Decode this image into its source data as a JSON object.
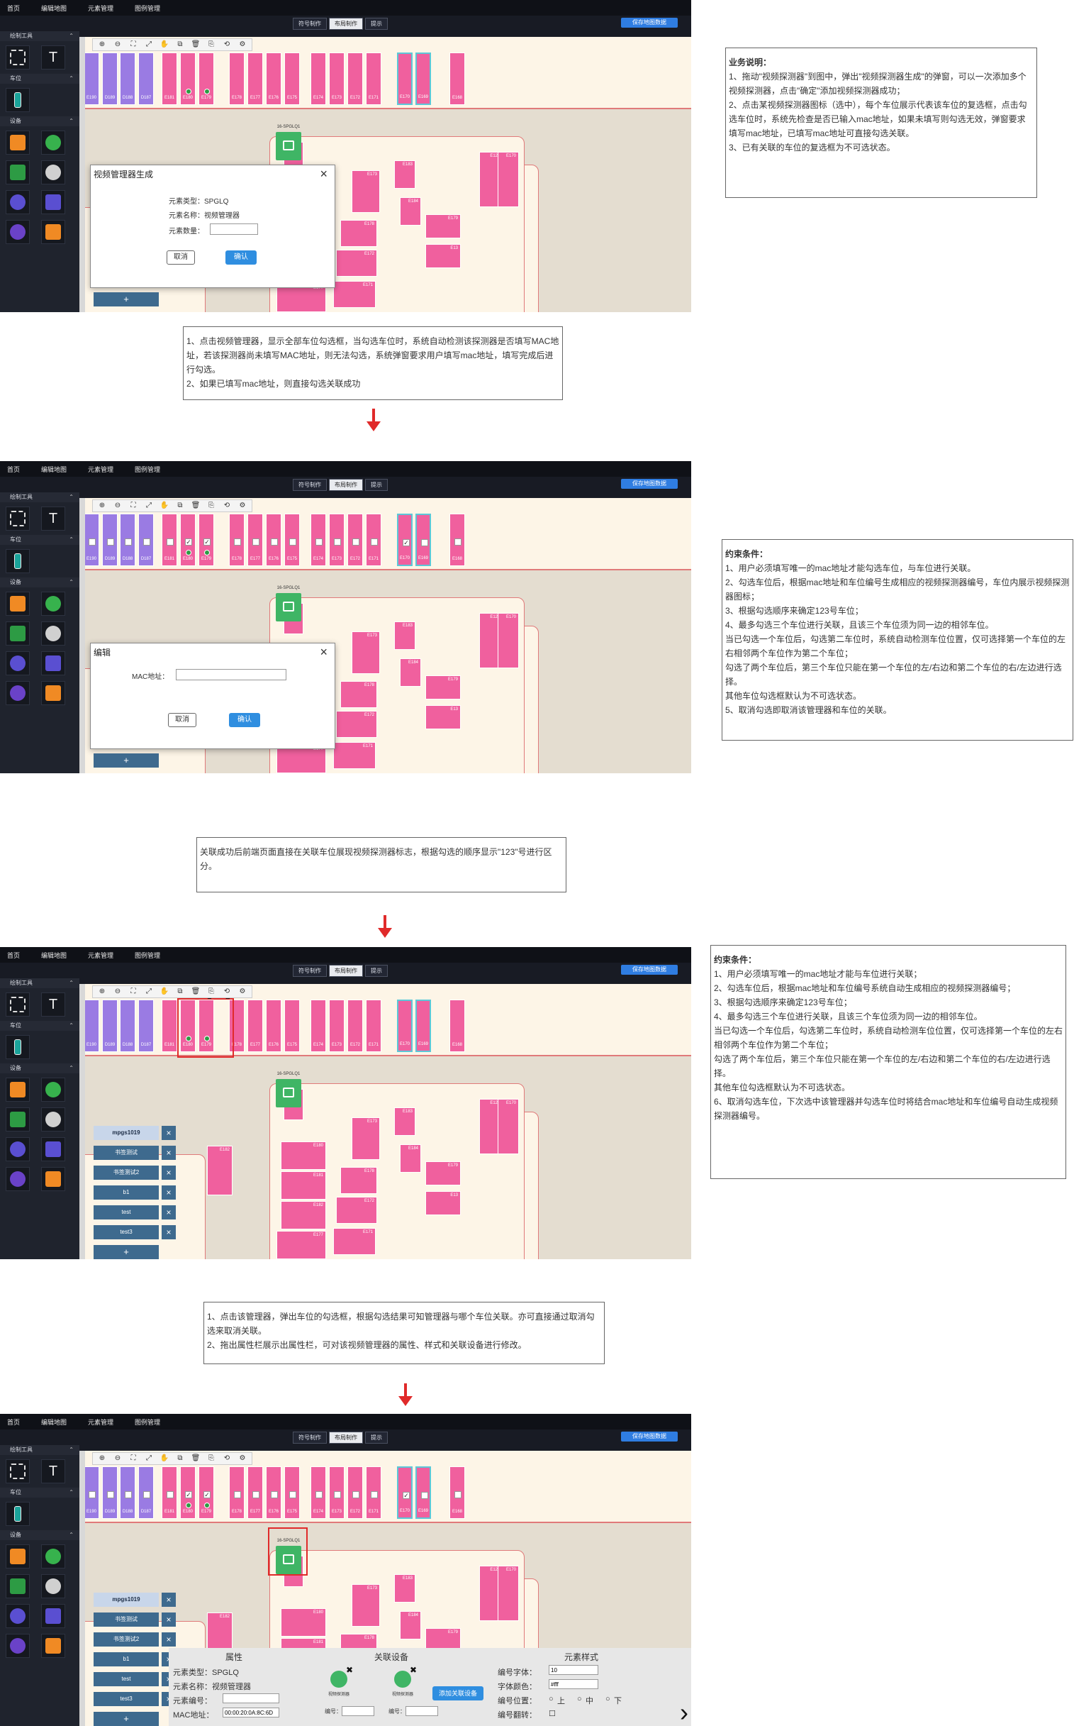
{
  "app": {
    "nav": [
      "首页",
      "编辑地图",
      "元素管理",
      "图例管理"
    ],
    "modes": [
      "符号制作",
      "布局制作",
      "提示"
    ],
    "save_label": "保存地图数据",
    "sections": {
      "draw_tools": "绘制工具",
      "parking": "车位",
      "devices": "设备"
    },
    "zoom_tools": [
      "zoom-in-icon",
      "zoom-out-icon",
      "fit-icon",
      "fullscreen-icon",
      "hand-icon",
      "copy-icon",
      "delete-icon",
      "undo-icon",
      "redo-icon",
      "settings-icon"
    ],
    "zoom_glyphs": [
      "⊕",
      "⊖",
      "⛶",
      "⤢",
      "✋",
      "⧉",
      "🗑",
      "⎘",
      "⟲",
      "⚙"
    ],
    "slot_labels": [
      "E190",
      "D189",
      "D188",
      "D187",
      "E181",
      "E180",
      "E179",
      "E178",
      "E177",
      "E176",
      "E175",
      "E174",
      "E173",
      "E172",
      "E171",
      "E170",
      "E169",
      "E168"
    ],
    "gateway_label": "16-SPGLQ1",
    "building_labels": [
      "E22",
      "E180",
      "E181",
      "E182",
      "E177",
      "E173",
      "E178",
      "E172",
      "E171",
      "E183",
      "E184",
      "E179",
      "E13",
      "E12",
      "E170",
      "E182",
      "D02",
      "D01"
    ],
    "manager_list": [
      "mpgs1019",
      "书签测试",
      "书签测试2",
      "b1",
      "test",
      "test3"
    ],
    "add_glyph": "+",
    "close_glyph": "×",
    "colors": {
      "purple_slot": "#9a7be3",
      "pink_slot": "#f0609e",
      "accent": "#2f8ee0",
      "nav_bg": "#0f1117",
      "highlight": "#e02a2a"
    }
  },
  "screens": [
    {
      "dialog": {
        "title": "视频管理器生成",
        "type_label": "元素类型：SPGLQ",
        "name_label": "元素名称：视频管理器",
        "count_label": "元素数量：",
        "count_value": "",
        "cancel": "取消",
        "ok": "确认"
      }
    },
    {
      "checked_slots": [
        "E180",
        "E179",
        "E170"
      ],
      "dialog": {
        "title": "编辑",
        "mac_label": "MAC地址：",
        "mac_value": "",
        "cancel": "取消",
        "ok": "确认"
      }
    },
    {
      "selected_numbers": [
        "1",
        "2"
      ]
    },
    {
      "checked_slots": [
        "E180",
        "E179",
        "E170"
      ],
      "props": {
        "headers": [
          "属性",
          "关联设备",
          "元素样式"
        ],
        "type": "元素类型：SPGLQ",
        "name": "元素名称：视频管理器",
        "code_label": "元素编号：",
        "code_value": "",
        "mac_label": "MAC地址：",
        "mac_value": "00:00:20:0A:8C:6D",
        "devices": [
          "视频探测器",
          "视频探测器"
        ],
        "dev_code_label": "编号：",
        "add_device": "添加关联设备",
        "font_label": "编号字体：",
        "font_value": "10",
        "color_label": "字体颜色：",
        "color_value": "#fff",
        "pos_label": "编号位置：",
        "pos_options": [
          "上",
          "中",
          "下"
        ],
        "flip_label": "编号翻转："
      }
    }
  ],
  "notes": {
    "business": {
      "lines": [
        "业务说明：",
        "1、拖动\"视频探测器\"到图中，弹出\"视频探测器生成\"的弹窗，可以一次添加多个视频探测器，点击\"确定\"添加视频探测器成功；",
        "",
        "2、点击某视频探测器图标（选中），每个车位展示代表该车位的复选框，点击勾选车位时，系统先检查是否已输入mac地址，如果未填写则勾选无效，弹窗要求填写mac地址，已填写mac地址可直接勾选关联。",
        "",
        "3、已有关联的车位的复选框为不可选状态。"
      ]
    },
    "step1": {
      "lines": [
        "1、点击视频管理器，显示全部车位勾选框，当勾选车位时，系统自动检测该探测器是否填写MAC地址，若该探测器尚未填写MAC地址，则无法勾选，系统弹窗要求用户填写mac地址，填写完成后进行勾选。",
        "2、如果已填写mac地址，则直接勾选关联成功"
      ]
    },
    "constraints1": {
      "lines": [
        "约束条件：",
        "1、用户必须填写唯一的mac地址才能勾选车位，与车位进行关联。",
        "2、勾选车位后，根据mac地址和车位编号生成相应的视频探测器编号，车位内展示视频探测器图标；",
        "3、根据勾选顺序来确定123号车位；",
        "4、最多勾选三个车位进行关联，且该三个车位须为同一边的相邻车位。",
        "当已勾选一个车位后，勾选第二车位时，系统自动检测车位位置，仅可选择第一个车位的左右相邻两个车位作为第二个车位；",
        "勾选了两个车位后，第三个车位只能在第一个车位的左/右边和第二个车位的右/左边进行选择。",
        "其他车位勾选框默认为不可选状态。",
        "5、取消勾选即取消该管理器和车位的关联。"
      ]
    },
    "step2": {
      "lines": [
        "关联成功后前端页面直接在关联车位展现视频探测器标志，根据勾选的顺序显示\"123\"号进行区分。"
      ]
    },
    "constraints2": {
      "lines": [
        "约束条件：",
        "",
        "1、用户必须填写唯一的mac地址才能与车位进行关联；",
        "2、勾选车位后，根据mac地址和车位编号系统自动生成相应的视频探测器编号；",
        "3、根据勾选顺序来确定123号车位；",
        "4、最多勾选三个车位进行关联，且该三个车位须为同一边的相邻车位。",
        "当已勾选一个车位后，勾选第二车位时，系统自动检测车位位置，仅可选择第一个车位的左右相邻两个车位作为第二个车位；",
        "勾选了两个车位后，第三个车位只能在第一个车位的左/右边和第二个车位的右/左边进行选择。",
        "其他车位勾选框默认为不可选状态。",
        "6、取消勾选车位，下次选中该管理器并勾选车位时将结合mac地址和车位编号自动生成视频探测器编号。"
      ]
    },
    "step3": {
      "lines": [
        "1、点击该管理器，弹出车位的勾选框，根据勾选结果可知管理器与哪个车位关联。亦可直接通过取消勾选来取消关联。",
        "2、拖出属性栏展示出属性栏，可对该视频管理器的属性、样式和关联设备进行修改。"
      ]
    }
  }
}
